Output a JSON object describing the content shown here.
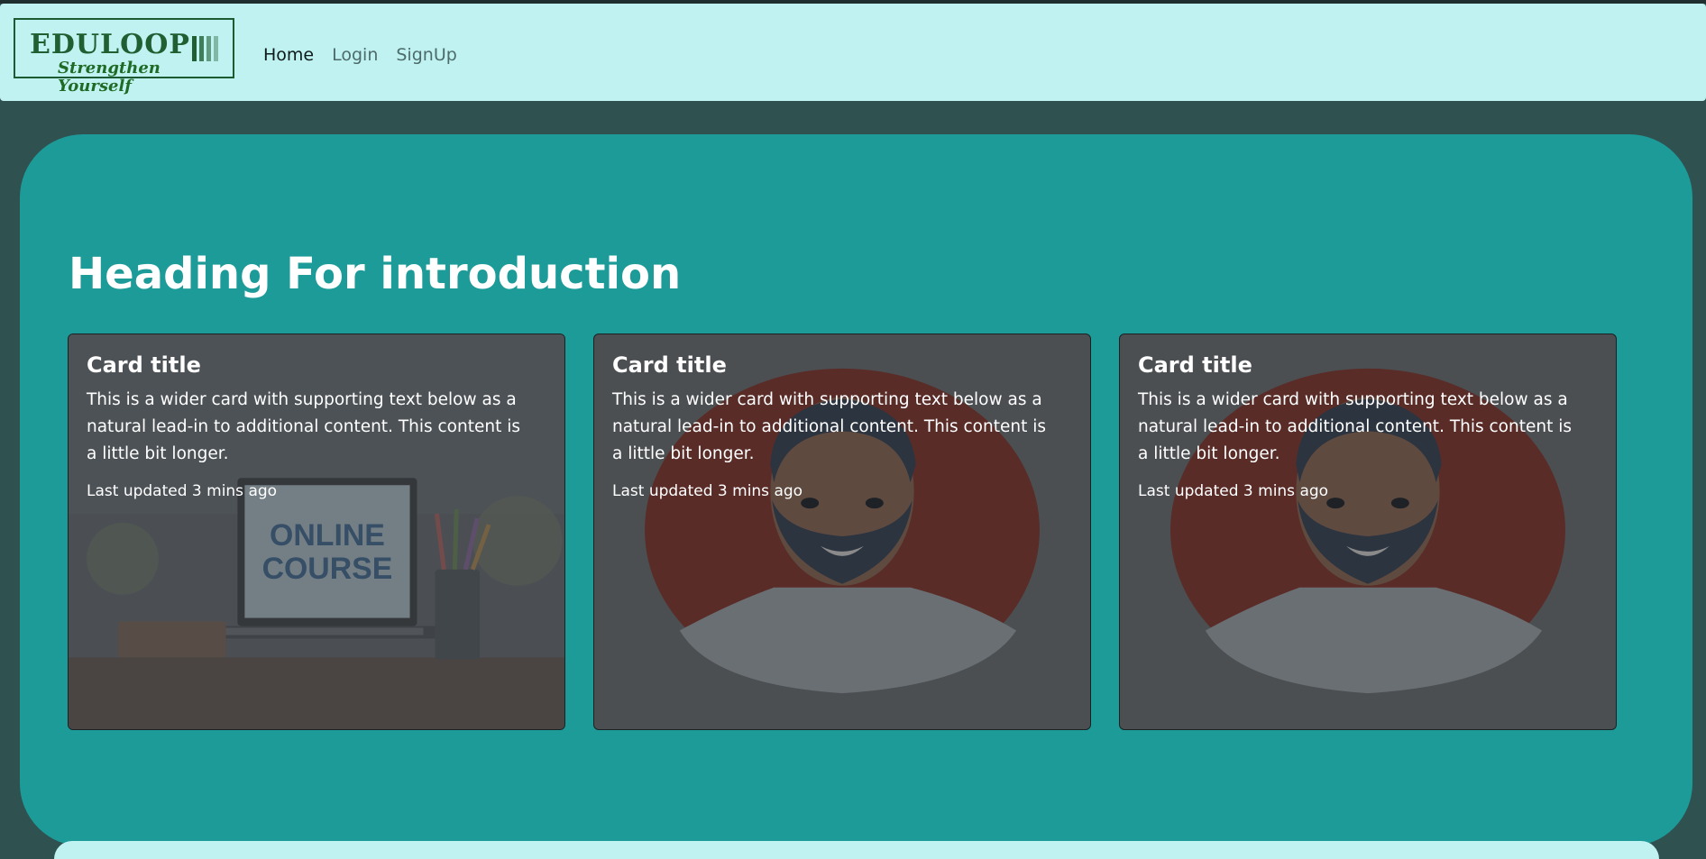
{
  "navbar": {
    "brand": {
      "name": "EDULOOP",
      "tagline": "Strengthen Yourself"
    },
    "links": [
      {
        "label": "Home",
        "active": true
      },
      {
        "label": "Login",
        "active": false
      },
      {
        "label": "SignUp",
        "active": false
      }
    ]
  },
  "hero": {
    "heading": "Heading For introduction",
    "cards": [
      {
        "title": "Card title",
        "text": "This is a wider card with supporting text below as a natural lead-in to additional content. This content is a little bit longer.",
        "meta": "Last updated 3 mins ago",
        "image_text": [
          "ONLINE",
          "COURSE"
        ]
      },
      {
        "title": "Card title",
        "text": "This is a wider card with supporting text below as a natural lead-in to additional content. This content is a little bit longer.",
        "meta": "Last updated 3 mins ago"
      },
      {
        "title": "Card title",
        "text": "This is a wider card with supporting text below as a natural lead-in to additional content. This content is a little bit longer.",
        "meta": "Last updated 3 mins ago"
      }
    ]
  },
  "colors": {
    "page_bg": "#2f5150",
    "navbar_bg": "#c1f2f2",
    "hero_bg": "#1d9b99",
    "card_bg": "#4b4f52",
    "brand_green": "#1f5f32"
  }
}
